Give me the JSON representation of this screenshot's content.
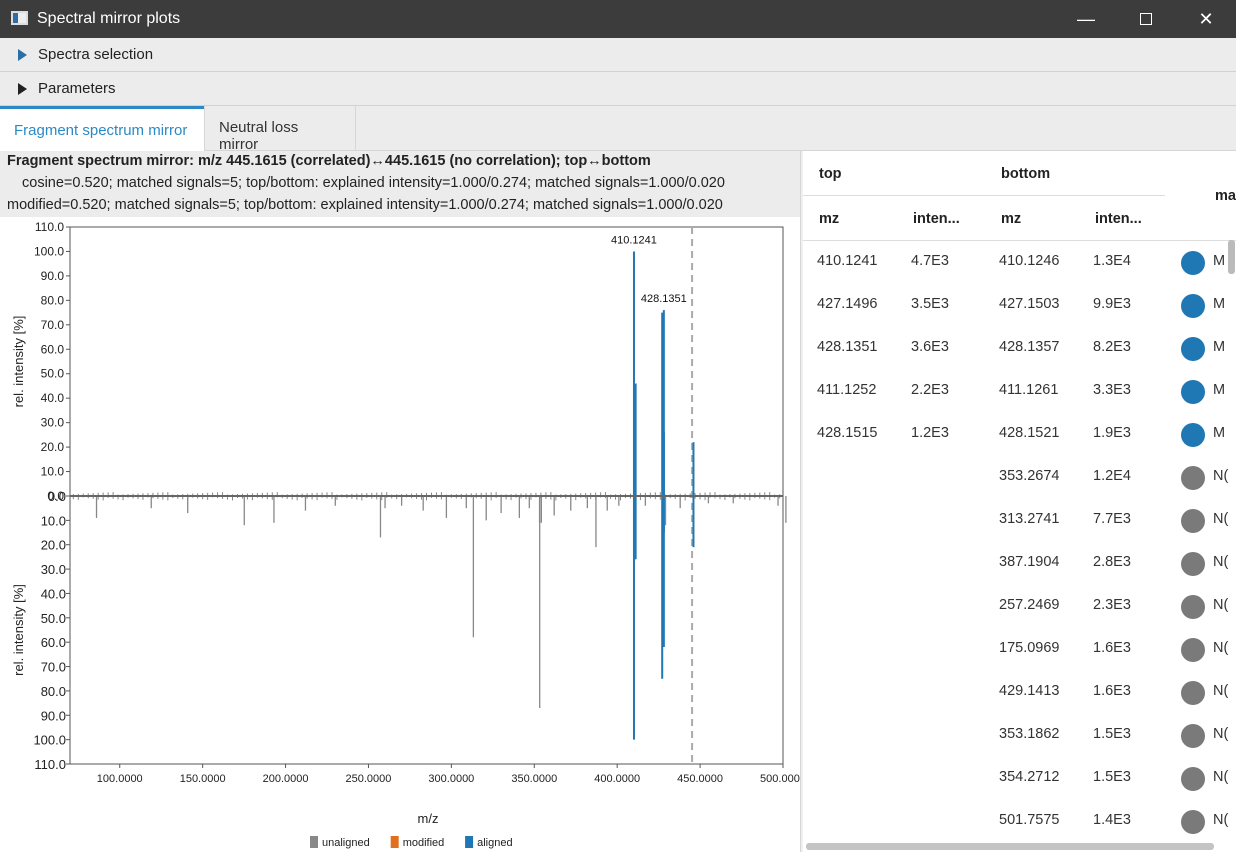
{
  "window": {
    "title": "Spectral mirror plots",
    "min_icon": "minimize-icon",
    "max_icon": "maximize-icon",
    "close_icon": "close-icon"
  },
  "accordion": {
    "spectra_selection": "Spectra selection",
    "parameters": "Parameters"
  },
  "tabs": [
    "Fragment spectrum mirror",
    "Neutral loss mirror"
  ],
  "chart_header": {
    "line1": "Fragment spectrum mirror: m/z 445.1615 (correlated)↔445.1615 (no correlation); top↔bottom",
    "line2": "cosine=0.520; matched signals=5; top/bottom: explained intensity=1.000/0.274; matched signals=1.000/0.020",
    "line3": "modified=0.520; matched signals=5; top/bottom: explained intensity=1.000/0.274; matched signals=1.000/0.020"
  },
  "chart_data": {
    "type": "bar",
    "xlabel": "m/z",
    "ylabel_top": "rel. intensity [%]",
    "ylabel_bottom": "rel. intensity [%]",
    "xlim": [
      70,
      500
    ],
    "x_ticks": [
      "100.0000",
      "150.0000",
      "200.0000",
      "250.0000",
      "300.0000",
      "350.0000",
      "400.0000",
      "450.0000",
      "500.0000"
    ],
    "x_tick_values": [
      100,
      150,
      200,
      250,
      300,
      350,
      400,
      450,
      500
    ],
    "y_ticks_top": [
      "110.0",
      "100.0",
      "90.0",
      "80.0",
      "70.0",
      "60.0",
      "50.0",
      "40.0",
      "30.0",
      "20.0",
      "10.0",
      "0.0"
    ],
    "y_ticks_bottom": [
      "0.0",
      "10.0",
      "20.0",
      "30.0",
      "40.0",
      "50.0",
      "60.0",
      "70.0",
      "80.0",
      "90.0",
      "100.0",
      "110.0"
    ],
    "ylim": [
      0,
      110
    ],
    "precursor_mz": 445.1615,
    "legend": [
      {
        "name": "unaligned",
        "color": "#888888"
      },
      {
        "name": "modified",
        "color": "#e07020"
      },
      {
        "name": "aligned",
        "color": "#1f77b4"
      }
    ],
    "annotations": [
      {
        "text": "410.1241",
        "x": 410.1241,
        "y": 100
      },
      {
        "text": "428.1351",
        "x": 428.1351,
        "y": 76
      }
    ],
    "top_series": [
      {
        "mz": 410.1241,
        "value": 100,
        "kind": "aligned"
      },
      {
        "mz": 411.1252,
        "value": 46,
        "kind": "aligned"
      },
      {
        "mz": 427.1496,
        "value": 75,
        "kind": "aligned"
      },
      {
        "mz": 428.1351,
        "value": 76,
        "kind": "aligned"
      },
      {
        "mz": 428.1515,
        "value": 26,
        "kind": "aligned"
      },
      {
        "mz": 446.0,
        "value": 22,
        "kind": "aligned"
      }
    ],
    "bottom_series": [
      {
        "mz": 410.1246,
        "value": 100,
        "kind": "aligned"
      },
      {
        "mz": 411.1261,
        "value": 26,
        "kind": "aligned"
      },
      {
        "mz": 427.1503,
        "value": 75,
        "kind": "aligned"
      },
      {
        "mz": 428.1357,
        "value": 62,
        "kind": "aligned"
      },
      {
        "mz": 428.1521,
        "value": 15,
        "kind": "aligned"
      },
      {
        "mz": 446.0,
        "value": 21,
        "kind": "aligned"
      },
      {
        "mz": 353.2674,
        "value": 87,
        "kind": "unaligned"
      },
      {
        "mz": 313.2741,
        "value": 58,
        "kind": "unaligned"
      },
      {
        "mz": 387.1904,
        "value": 21,
        "kind": "unaligned"
      },
      {
        "mz": 257.2469,
        "value": 17,
        "kind": "unaligned"
      },
      {
        "mz": 175.0969,
        "value": 12,
        "kind": "unaligned"
      },
      {
        "mz": 429.1413,
        "value": 12,
        "kind": "unaligned"
      },
      {
        "mz": 353.1862,
        "value": 11,
        "kind": "unaligned"
      },
      {
        "mz": 354.2712,
        "value": 11,
        "kind": "unaligned"
      },
      {
        "mz": 501.7575,
        "value": 11,
        "kind": "unaligned"
      },
      {
        "mz": 86.0,
        "value": 9,
        "kind": "unaligned"
      },
      {
        "mz": 119.0,
        "value": 5,
        "kind": "unaligned"
      },
      {
        "mz": 141.0,
        "value": 7,
        "kind": "unaligned"
      },
      {
        "mz": 193.0,
        "value": 11,
        "kind": "unaligned"
      },
      {
        "mz": 212.0,
        "value": 6,
        "kind": "unaligned"
      },
      {
        "mz": 230.0,
        "value": 4,
        "kind": "unaligned"
      },
      {
        "mz": 260.0,
        "value": 5,
        "kind": "unaligned"
      },
      {
        "mz": 270.0,
        "value": 4,
        "kind": "unaligned"
      },
      {
        "mz": 283.0,
        "value": 6,
        "kind": "unaligned"
      },
      {
        "mz": 297.0,
        "value": 9,
        "kind": "unaligned"
      },
      {
        "mz": 309.0,
        "value": 5,
        "kind": "unaligned"
      },
      {
        "mz": 321.0,
        "value": 10,
        "kind": "unaligned"
      },
      {
        "mz": 330.0,
        "value": 7,
        "kind": "unaligned"
      },
      {
        "mz": 341.0,
        "value": 9,
        "kind": "unaligned"
      },
      {
        "mz": 347.0,
        "value": 5,
        "kind": "unaligned"
      },
      {
        "mz": 362.0,
        "value": 8,
        "kind": "unaligned"
      },
      {
        "mz": 372.0,
        "value": 6,
        "kind": "unaligned"
      },
      {
        "mz": 382.0,
        "value": 5,
        "kind": "unaligned"
      },
      {
        "mz": 394.0,
        "value": 6,
        "kind": "unaligned"
      },
      {
        "mz": 401.0,
        "value": 4,
        "kind": "unaligned"
      },
      {
        "mz": 417.0,
        "value": 4,
        "kind": "unaligned"
      },
      {
        "mz": 438.0,
        "value": 5,
        "kind": "unaligned"
      },
      {
        "mz": 455.0,
        "value": 3,
        "kind": "unaligned"
      },
      {
        "mz": 470.0,
        "value": 3,
        "kind": "unaligned"
      },
      {
        "mz": 497.0,
        "value": 4,
        "kind": "unaligned"
      }
    ]
  },
  "table": {
    "group_top": "top",
    "group_bottom": "bottom",
    "col_mz": "mz",
    "col_inten": "inten...",
    "col_match": "ma",
    "rows": [
      {
        "top_mz": "410.1241",
        "top_int": "4.7E3",
        "bot_mz": "410.1246",
        "bot_int": "1.3E4",
        "match": "M",
        "color": "#1f77b4"
      },
      {
        "top_mz": "427.1496",
        "top_int": "3.5E3",
        "bot_mz": "427.1503",
        "bot_int": "9.9E3",
        "match": "M",
        "color": "#1f77b4"
      },
      {
        "top_mz": "428.1351",
        "top_int": "3.6E3",
        "bot_mz": "428.1357",
        "bot_int": "8.2E3",
        "match": "M",
        "color": "#1f77b4"
      },
      {
        "top_mz": "411.1252",
        "top_int": "2.2E3",
        "bot_mz": "411.1261",
        "bot_int": "3.3E3",
        "match": "M",
        "color": "#1f77b4"
      },
      {
        "top_mz": "428.1515",
        "top_int": "1.2E3",
        "bot_mz": "428.1521",
        "bot_int": "1.9E3",
        "match": "M",
        "color": "#1f77b4"
      },
      {
        "top_mz": "",
        "top_int": "",
        "bot_mz": "353.2674",
        "bot_int": "1.2E4",
        "match": "N(",
        "color": "#7a7a7a"
      },
      {
        "top_mz": "",
        "top_int": "",
        "bot_mz": "313.2741",
        "bot_int": "7.7E3",
        "match": "N(",
        "color": "#7a7a7a"
      },
      {
        "top_mz": "",
        "top_int": "",
        "bot_mz": "387.1904",
        "bot_int": "2.8E3",
        "match": "N(",
        "color": "#7a7a7a"
      },
      {
        "top_mz": "",
        "top_int": "",
        "bot_mz": "257.2469",
        "bot_int": "2.3E3",
        "match": "N(",
        "color": "#7a7a7a"
      },
      {
        "top_mz": "",
        "top_int": "",
        "bot_mz": "175.0969",
        "bot_int": "1.6E3",
        "match": "N(",
        "color": "#7a7a7a"
      },
      {
        "top_mz": "",
        "top_int": "",
        "bot_mz": "429.1413",
        "bot_int": "1.6E3",
        "match": "N(",
        "color": "#7a7a7a"
      },
      {
        "top_mz": "",
        "top_int": "",
        "bot_mz": "353.1862",
        "bot_int": "1.5E3",
        "match": "N(",
        "color": "#7a7a7a"
      },
      {
        "top_mz": "",
        "top_int": "",
        "bot_mz": "354.2712",
        "bot_int": "1.5E3",
        "match": "N(",
        "color": "#7a7a7a"
      },
      {
        "top_mz": "",
        "top_int": "",
        "bot_mz": "501.7575",
        "bot_int": "1.4E3",
        "match": "N(",
        "color": "#7a7a7a"
      }
    ]
  }
}
